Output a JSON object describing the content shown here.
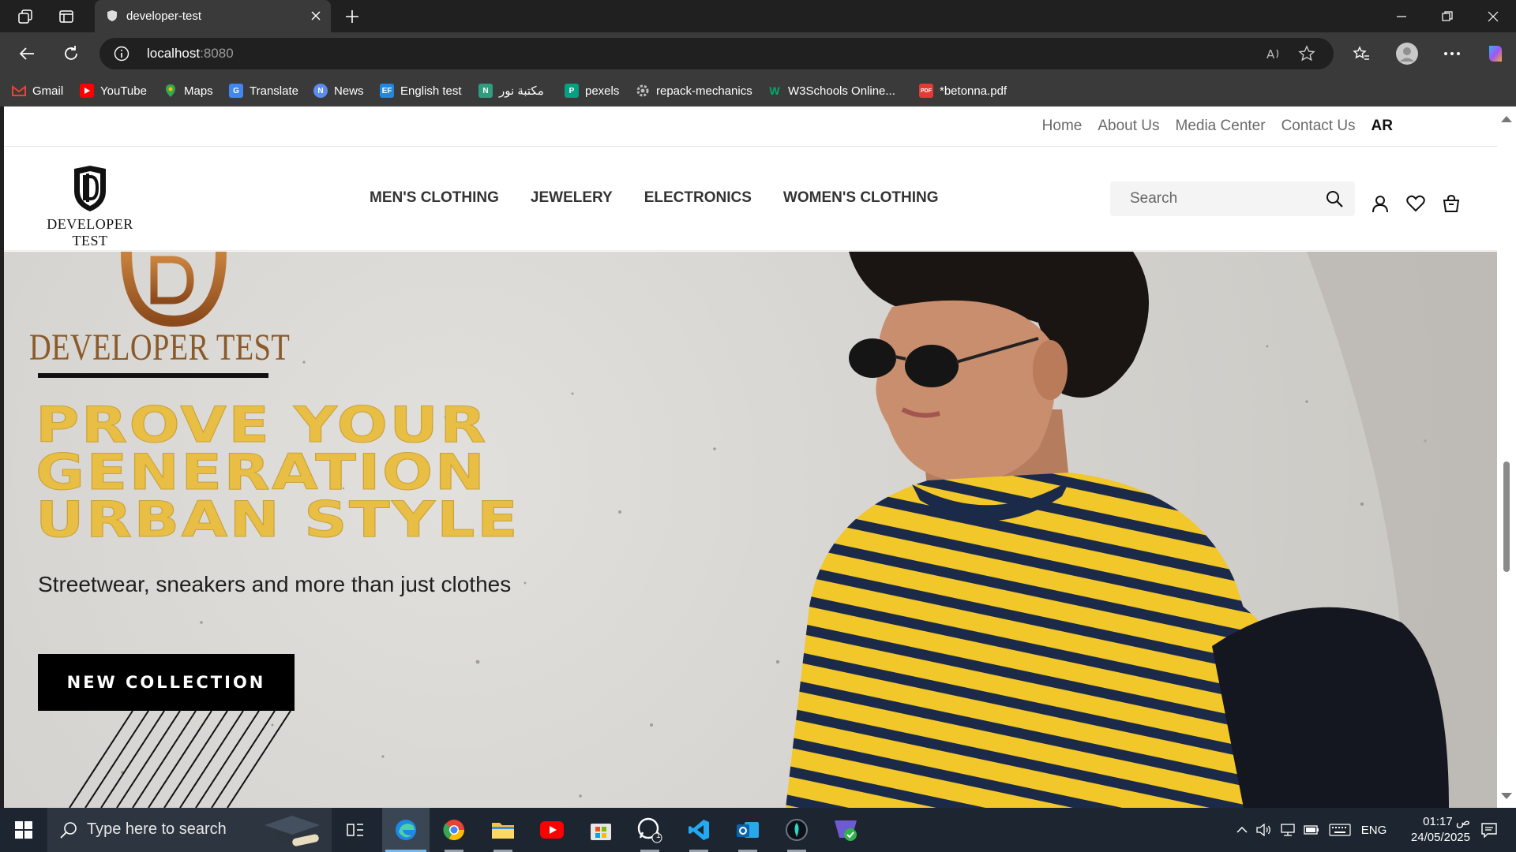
{
  "browser": {
    "tab_title": "developer-test",
    "url_host": "localhost",
    "url_port": ":8080",
    "bookmarks": [
      {
        "label": "Gmail",
        "icon": "gmail-icon",
        "color": "#ea4335"
      },
      {
        "label": "YouTube",
        "icon": "youtube-icon",
        "color": "#ff0000"
      },
      {
        "label": "Maps",
        "icon": "maps-icon",
        "color": "#34a853"
      },
      {
        "label": "Translate",
        "icon": "translate-icon",
        "color": "#4285f4"
      },
      {
        "label": "News",
        "icon": "news-icon",
        "color": "#5b8def"
      },
      {
        "label": "English test",
        "icon": "ef-icon",
        "color": "#1e88e5"
      },
      {
        "label": "مكتبة نور",
        "icon": "noor-library-icon",
        "color": "#2e9e7f"
      },
      {
        "label": "pexels",
        "icon": "pexels-icon",
        "color": "#05a081"
      },
      {
        "label": "repack-mechanics",
        "icon": "gear-icon",
        "color": "#8a8f98"
      },
      {
        "label": "W3Schools Online...",
        "icon": "w3schools-icon",
        "color": "#04aa6d"
      },
      {
        "label": "*betonna.pdf",
        "icon": "pdf-icon",
        "color": "#e53935"
      }
    ]
  },
  "site": {
    "util_nav": [
      "Home",
      "About Us",
      "Media Center",
      "Contact Us"
    ],
    "lang_toggle": "AR",
    "brand": "DEVELOPER TEST",
    "categories": [
      "MEN'S CLOTHING",
      "JEWELERY",
      "ELECTRONICS",
      "WOMEN'S CLOTHING"
    ],
    "search_placeholder": "Search",
    "hero": {
      "brand": "DEVELOPER TEST",
      "headline": [
        "PROVE YOUR",
        "GENERATION",
        "URBAN STYLE"
      ],
      "tagline": "Streetwear, sneakers and more than just clothes",
      "cta": "NEW COLLECTION"
    },
    "colors": {
      "accent": "#e8be45",
      "brand_bronze": "#8b5a2b",
      "text": "#333333"
    }
  },
  "taskbar": {
    "search_placeholder": "Type here to search",
    "language": "ENG",
    "time": "01:17 ص",
    "date": "24/05/2025",
    "whatsapp_badge": "1"
  }
}
